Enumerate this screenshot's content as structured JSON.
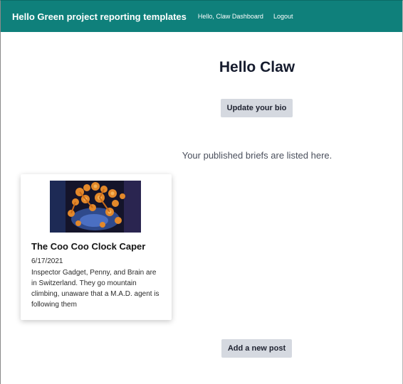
{
  "navbar": {
    "brand": "Hello Green project reporting templates",
    "links": [
      {
        "label": "Hello, Claw Dashboard"
      },
      {
        "label": "Logout"
      }
    ],
    "color": "#0f807b"
  },
  "main": {
    "title": "Hello Claw",
    "update_bio_label": "Update your bio",
    "briefs_note": "Your published briefs are listed here.",
    "add_post_label": "Add a new post"
  },
  "briefs": [
    {
      "title": "The Coo Coo Clock Caper",
      "date": "6/17/2021",
      "description": "Inspector Gadget, Penny, and Brain are in Switzerland. They go mountain climbing, unaware that a M.A.D. agent is following them"
    }
  ]
}
